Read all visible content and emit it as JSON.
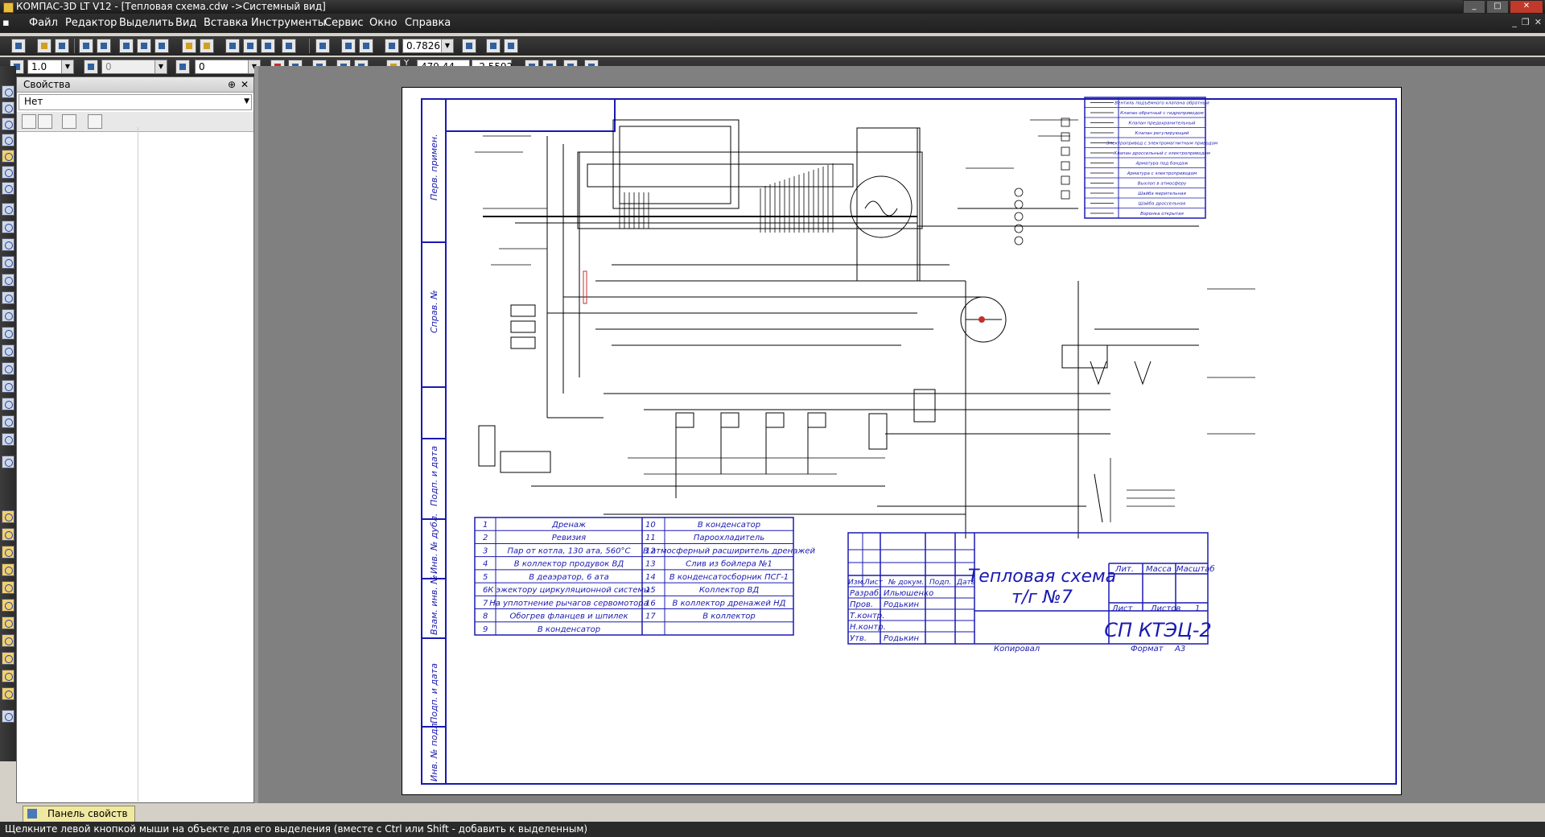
{
  "window": {
    "title": "КОМПАС-3D LT V12 - [Тепловая схема.cdw ->Системный вид]",
    "buttons": [
      "_",
      "□",
      "✕"
    ]
  },
  "menu": [
    {
      "label": "Файл"
    },
    {
      "label": "Редактор"
    },
    {
      "label": "Выделить"
    },
    {
      "label": "Вид"
    },
    {
      "label": "Вставка"
    },
    {
      "label": "Инструменты"
    },
    {
      "label": "Сервис"
    },
    {
      "label": "Окно"
    },
    {
      "label": "Справка"
    }
  ],
  "toolbar": {
    "zoom_value": "0.7826",
    "line_step": "1.0",
    "layer_value": "0",
    "style_value": "0",
    "coord_x": "479.44",
    "coord_y": "-2.5592",
    "coord_x_label": "X",
    "coord_y_label": "Y"
  },
  "properties_panel": {
    "title": "Свойства",
    "pin": "⊕",
    "close": "✕",
    "select_value": "Нет"
  },
  "bottom_tab": {
    "label": "Панель свойств"
  },
  "status": {
    "message": "Щелкните левой кнопкой мыши на объекте для его выделения (вместе с Ctrl или Shift - добавить к выделенным)"
  },
  "drawing": {
    "side_labels": [
      "Перв. примен.",
      "Справ. №",
      "Подп. и дата",
      "Инв. № дубл.",
      "Взам. инв. №",
      "Подп. и дата",
      "Инв. № подл."
    ],
    "legend_rows": [
      "Вентиль подъёмного клапана обратный",
      "Клапан обратный с гидроприводом",
      "Клапан предохранительный",
      "Клапан регулирующий",
      "Электропривод с электромагнитным приводом",
      "Клапан дроссельный с электроприводом",
      "Арматура под бандаж",
      "Арматура с электроприводом",
      "Выхлоп в атмосферу",
      "Шайба мерительная",
      "Шайба дроссельная",
      "Воронка открытая"
    ],
    "table_left": [
      {
        "n": "1",
        "text": "Дренаж"
      },
      {
        "n": "2",
        "text": "Ревизия"
      },
      {
        "n": "3",
        "text": "Пар от котла, 130 ата, 560°С"
      },
      {
        "n": "4",
        "text": "В коллектор продувок ВД"
      },
      {
        "n": "5",
        "text": "В деаэратор, 6 ата"
      },
      {
        "n": "6",
        "text": "К эжектору циркуляционной системы"
      },
      {
        "n": "7",
        "text": "На уплотнение рычагов сервомотора"
      },
      {
        "n": "8",
        "text": "Обогрев фланцев и шпилек"
      },
      {
        "n": "9",
        "text": "В конденсатор"
      }
    ],
    "table_right": [
      {
        "n": "10",
        "text": "В конденсатор"
      },
      {
        "n": "11",
        "text": "Пароохладитель"
      },
      {
        "n": "12",
        "text": "В атмосферный расширитель дренажей"
      },
      {
        "n": "13",
        "text": "Слив из бойлера №1"
      },
      {
        "n": "14",
        "text": "В конденсатосборник ПСГ-1"
      },
      {
        "n": "15",
        "text": "Коллектор ВД"
      },
      {
        "n": "16",
        "text": "В коллектор дренажей НД"
      },
      {
        "n": "17",
        "text": "В коллектор"
      }
    ],
    "title_block": {
      "title_line1": "Тепловая схема",
      "title_line2": "т/г №7",
      "code": "СП КТЭЦ-2",
      "hdr_izm": "Изм.",
      "hdr_list": "Лист",
      "hdr_ndoc": "№ докум.",
      "hdr_podp": "Подп.",
      "hdr_data": "Дата",
      "role_razrab": "Разраб.",
      "role_prov": "Пров.",
      "role_tkontr": "Т.контр.",
      "role_nkontr": "Н.контр.",
      "role_utv": "Утв.",
      "name_razrab": "Ильюшенко",
      "name_prov": "Родькин",
      "name_utv": "Родькин",
      "lit": "Лит.",
      "massa": "Масса",
      "masshtab": "Масштаб",
      "list": "Лист",
      "listov": "Листов",
      "listov_value": "1",
      "kopiroval": "Копировал",
      "format": "Формат",
      "format_value": "А3"
    }
  },
  "colors": {
    "frame": "#1a1ab0",
    "lines": "#000000",
    "highlight": "#c03030"
  }
}
